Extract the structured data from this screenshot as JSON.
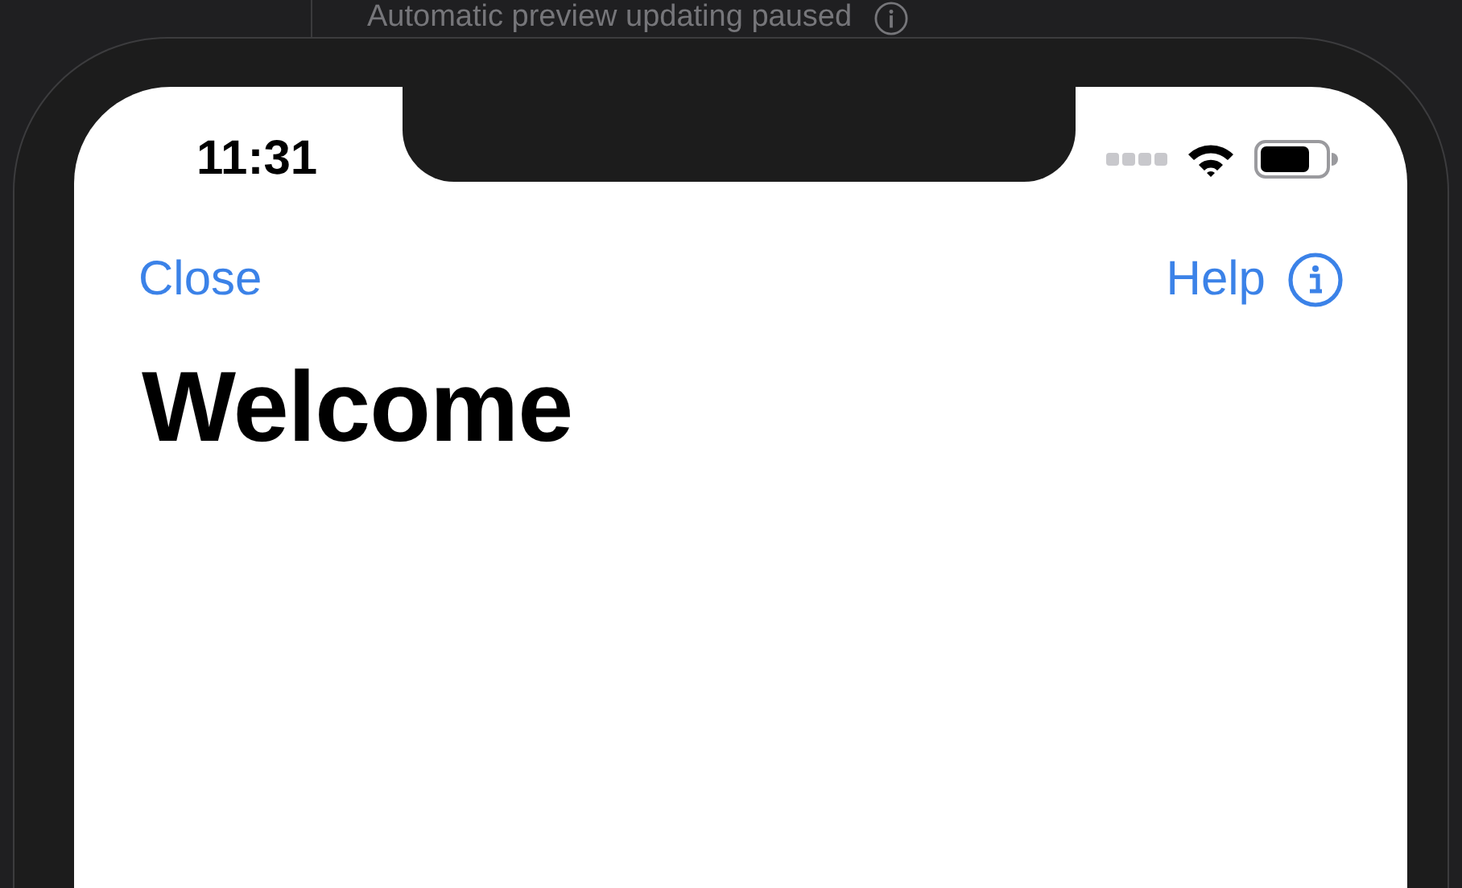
{
  "canvas_banner": {
    "text": "Automatic preview updating paused"
  },
  "status_bar": {
    "time": "11:31"
  },
  "nav_bar": {
    "leading": "Close",
    "trailing": "Help"
  },
  "title": "Welcome"
}
